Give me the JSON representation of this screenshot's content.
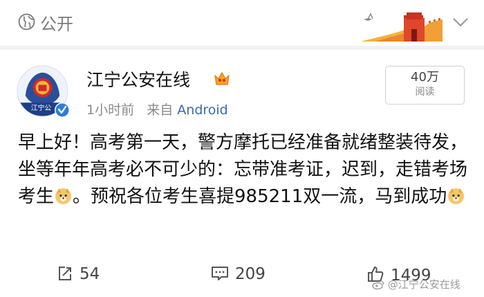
{
  "header": {
    "visibility_label": "公开"
  },
  "account": {
    "name": "江宁公安在线",
    "time": "1小时前",
    "source_prefix": "来自",
    "source": "Android",
    "avatar_text": "江宁公"
  },
  "reads": {
    "count": "40万",
    "label": "阅读"
  },
  "post": {
    "text_before_emoji": "早上好！高考第一天，警方摩托已经准备就绪整装待发，坐等年年高考必不可少的：忘带准考证，迟到，走错考场考生",
    "text_middle": "。预祝各位考生喜提985211双一流，马到成功"
  },
  "actions": {
    "repost_count": "54",
    "comment_count": "209",
    "like_count": "1499"
  },
  "watermark": "@江宁公安在线",
  "colors": {
    "link": "#3a6aa8",
    "meta": "#8a8a8a",
    "verified": "#2b7fd4"
  }
}
